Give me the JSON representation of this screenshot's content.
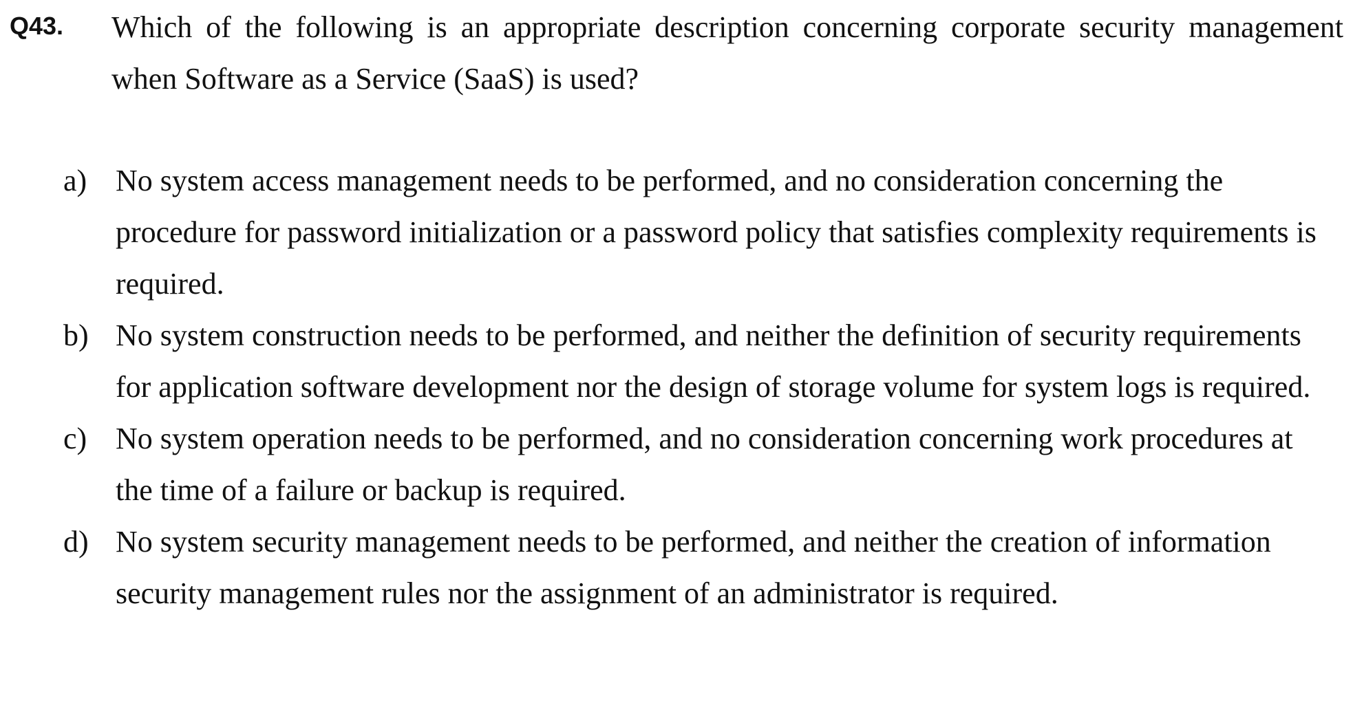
{
  "question": {
    "number": "Q43.",
    "text": "Which of the following is an appropriate description concerning corporate security management when Software as a Service (SaaS) is used?"
  },
  "options": [
    {
      "label": "a)",
      "text": "No system access management needs to be performed, and no consideration concerning the procedure for password initialization or a password policy that satisfies complexity requirements is required."
    },
    {
      "label": "b)",
      "text": "No system construction needs to be performed, and neither the definition of security requirements for application software development nor the design of storage volume for system logs is required."
    },
    {
      "label": "c)",
      "text": "No system operation needs to be performed, and no consideration concerning work procedures at the time of a failure or backup is required."
    },
    {
      "label": "d)",
      "text": "No system security management needs to be performed, and neither the creation of information security management rules nor the assignment of an administrator is required."
    }
  ]
}
